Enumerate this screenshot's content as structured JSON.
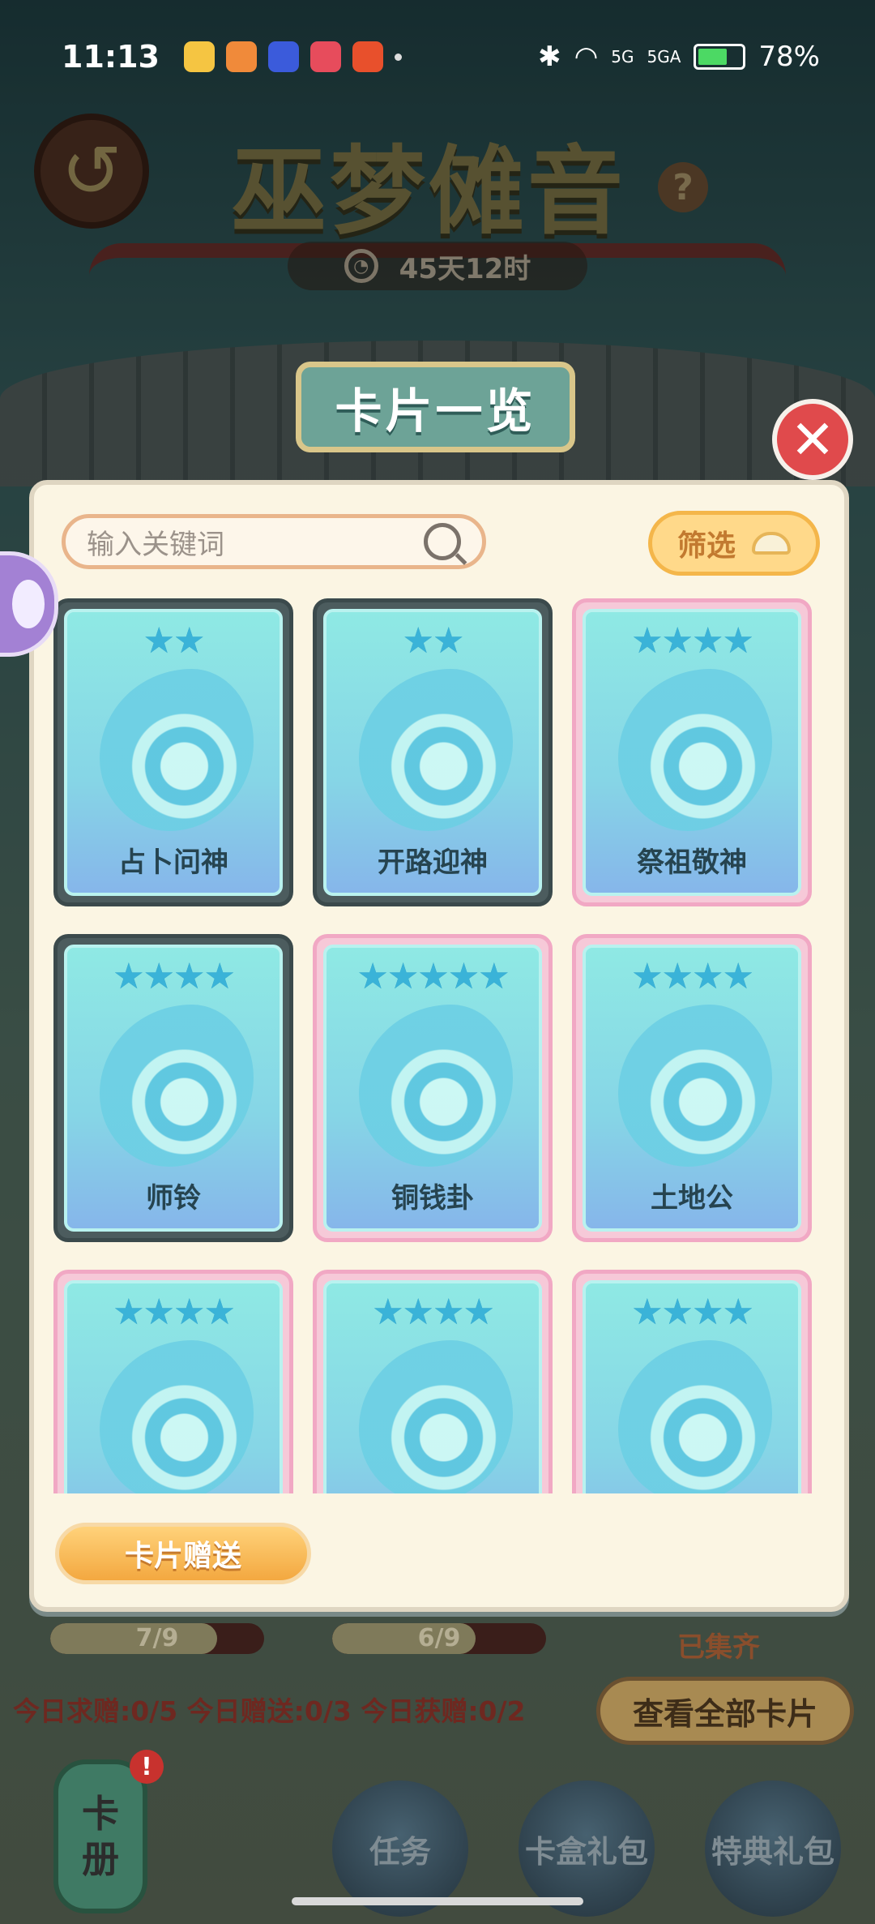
{
  "status": {
    "time": "11:13",
    "battery": "78%",
    "net1": "5G",
    "net2": "5GA"
  },
  "header": {
    "title": "巫梦傩音",
    "timer": "45天12时",
    "help": "?"
  },
  "dialog": {
    "banner": "卡片一览",
    "search": {
      "placeholder": "输入关键词"
    },
    "filter_label": "筛选",
    "cards": [
      {
        "name": "占卜问神",
        "stars": "★★",
        "style": "grey"
      },
      {
        "name": "开路迎神",
        "stars": "★★",
        "style": "grey"
      },
      {
        "name": "祭祖敬神",
        "stars": "★★★★",
        "style": "pink"
      },
      {
        "name": "师铃",
        "stars": "★★★★",
        "style": "grey"
      },
      {
        "name": "铜钱卦",
        "stars": "★★★★★",
        "style": "pink"
      },
      {
        "name": "土地公",
        "stars": "★★★★",
        "style": "pink"
      },
      {
        "name": "",
        "stars": "★★★★",
        "style": "pink"
      },
      {
        "name": "",
        "stars": "★★★★",
        "style": "pink"
      },
      {
        "name": "",
        "stars": "★★★★",
        "style": "pink"
      }
    ],
    "gift_button": "卡片赠送"
  },
  "bottom": {
    "progress": [
      {
        "label": "7/9",
        "fraction": 0.78
      },
      {
        "label": "6/9",
        "fraction": 0.67
      }
    ],
    "collected": "已集齐",
    "quota": "今日求赠:0/5 今日赠送:0/3 今日获赠:0/2",
    "view_all": "查看全部卡片",
    "lantern": {
      "line1": "卡",
      "line2": "册",
      "badge": "!"
    },
    "nav": [
      "任务",
      "卡盒礼包",
      "特典礼包"
    ]
  },
  "colors": {
    "accent": "#6da397",
    "close": "#e04a4c",
    "gift": "#f3a840"
  }
}
